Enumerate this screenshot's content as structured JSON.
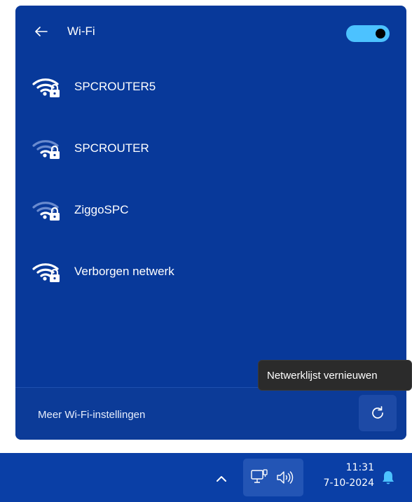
{
  "panel": {
    "title": "Wi-Fi",
    "toggle_on": true,
    "accent_color": "#4cc2ff",
    "background_color": "#08399a",
    "networks": [
      {
        "name": "SPCROUTER5",
        "icon": "wifi-secured-icon",
        "signal_bars": 4
      },
      {
        "name": "SPCROUTER",
        "icon": "wifi-secured-icon",
        "signal_bars": 2
      },
      {
        "name": "ZiggoSPC",
        "icon": "wifi-secured-icon",
        "signal_bars": 2
      },
      {
        "name": "Verborgen netwerk",
        "icon": "wifi-secured-icon",
        "signal_bars": 4
      }
    ],
    "footer_link": "Meer Wi-Fi-instellingen",
    "refresh_icon": "refresh-icon"
  },
  "tooltip": {
    "text": "Netwerklijst vernieuwen"
  },
  "taskbar": {
    "background_color": "#0a3fa6",
    "chevron_icon": "chevron-up-icon",
    "network_icon": "network-wired-icon",
    "volume_icon": "speaker-icon",
    "time": "11:31",
    "date": "7-10-2024",
    "notification_icon": "bell-icon"
  }
}
